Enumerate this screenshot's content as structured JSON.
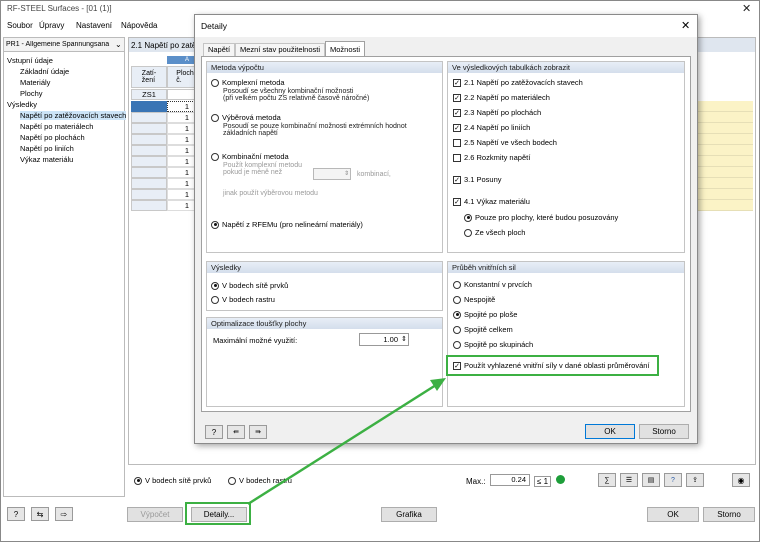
{
  "app": {
    "title": "RF-STEEL Surfaces - [01 (1)]",
    "menu": [
      "Soubor",
      "Úpravy",
      "Nastavení",
      "Nápověda"
    ],
    "case_select": "PŘ1 - Allgemeine Spannungsana",
    "tree": {
      "inputs_header": "Vstupní údaje",
      "inputs": [
        "Základní údaje",
        "Materiály",
        "Plochy"
      ],
      "results_header": "Výsledky",
      "results": [
        "Napětí po zatěžovacích stavech",
        "Napětí po materiálech",
        "Napětí po plochách",
        "Napětí po liniích",
        "Výkaz materiálu"
      ]
    },
    "table": {
      "title": "2.1 Napětí po zatěž",
      "col_a": "A",
      "col1_header": "Zatí-\nžení",
      "col2_header": "Plocha\nč.",
      "first_row": "ZS1",
      "rows": [
        "1",
        "1",
        "1",
        "1",
        "1",
        "1",
        "1",
        "1",
        "1",
        "1"
      ]
    },
    "bottom_bar": {
      "radio_mesh": "V bodech sítě prvků",
      "radio_grid": "V bodech rastru",
      "max_label": "Max.:",
      "max_value": "0.24",
      "le_symbol": "≤ 1"
    },
    "buttons": {
      "vypocet": "Výpočet",
      "detaily": "Detaily...",
      "grafika": "Grafika",
      "ok": "OK",
      "storno": "Storno"
    },
    "highlight_color": "#3cb043"
  },
  "dialog": {
    "title": "Detaily",
    "close": "✕",
    "tabs": [
      "Napětí",
      "Mezní stav použitelnosti",
      "Možnosti"
    ],
    "method": {
      "header": "Metoda výpočtu",
      "complex_label": "Komplexní metoda",
      "complex_desc": "Posoudí se všechny kombinační možnosti\n(při velkém počtu ZS relativně časově náročné)",
      "select_label": "Výběrová metoda",
      "select_desc": "Posoudí se pouze kombinační možnosti extrémních hodnot\nzákladních napětí",
      "comb_label": "Kombinační metoda",
      "comb_desc1": "Použít komplexní metodu\npokud je méně než",
      "comb_desc2": "kombinací,",
      "comb_desc3": "jinak použít výběrovou metodu",
      "rfem_label": "Napětí z RFEMu (pro nelineární materiály)"
    },
    "results": {
      "header": "Výsledky",
      "mesh": "V bodech sítě prvků",
      "grid": "V bodech rastru"
    },
    "optim": {
      "header": "Optimalizace tloušťky plochy",
      "label": "Maximální možné využití:",
      "value": "1.00"
    },
    "show": {
      "header": "Ve výsledkových tabulkách zobrazit",
      "items": [
        "2.1 Napětí po zatěžovacích stavech",
        "2.2 Napětí po materiálech",
        "2.3 Napětí po plochách",
        "2.4 Napětí po liniích",
        "2.5 Napětí ve všech bodech",
        "2.6 Rozkmity napětí"
      ],
      "posuny": "3.1 Posuny",
      "vykaz": "4.1 Výkaz materiálu",
      "vykaz_opt1": "Pouze pro plochy, které budou posuzovány",
      "vykaz_opt2": "Ze všech ploch"
    },
    "forces": {
      "header": "Průběh vnitřních sil",
      "options": [
        "Konstantní v prvcích",
        "Nespojitě",
        "Spojité po ploše",
        "Spojitě celkem",
        "Spojitě po skupinách"
      ],
      "smooth": "Použít vyhlazené vnitřní síly v dané oblasti průměrování"
    },
    "ok": "OK",
    "storno": "Storno"
  }
}
